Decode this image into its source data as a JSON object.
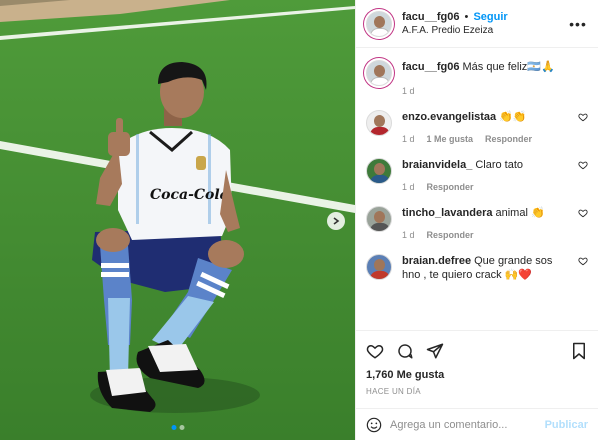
{
  "post": {
    "username": "facu__fg06",
    "follow_label": "Seguir",
    "separator": "•",
    "location": "A.F.A. Predio Ezeiza",
    "more_icon": "more-horizontal-icon"
  },
  "photo": {
    "jersey_sponsor": "Coca-Cola",
    "carousel_dots": 2,
    "active_dot": 0
  },
  "caption": {
    "username": "facu__fg06",
    "text": "Más que feliz🇦🇷🙏",
    "time": "1 d"
  },
  "comments": [
    {
      "username": "enzo.evangelistaa",
      "text": "👏👏",
      "time": "1 d",
      "likes": "1 Me gusta",
      "reply": "Responder"
    },
    {
      "username": "braianvidela_",
      "text": "Claro tato",
      "time": "1 d",
      "likes": "",
      "reply": "Responder"
    },
    {
      "username": "tincho_lavandera",
      "text": "animal 👏",
      "time": "1 d",
      "likes": "",
      "reply": "Responder"
    },
    {
      "username": "braian.defree",
      "text": "Que grande sos hno , te quiero crack 🙌❤️",
      "time": "",
      "likes": "",
      "reply": ""
    }
  ],
  "actions": {
    "likes": "1,760 Me gusta",
    "posted_ago": "HACE UN DÍA"
  },
  "add_comment": {
    "placeholder": "Agrega un comentario...",
    "publish_label": "Publicar"
  },
  "colors": {
    "link_blue": "#0095f6",
    "publish_disabled": "#b2dffc",
    "muted_text": "#8e8e8e",
    "grass": "#3f8a32"
  }
}
